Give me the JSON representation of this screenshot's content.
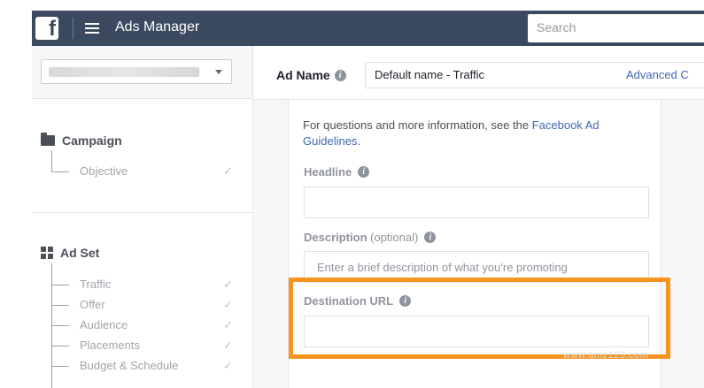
{
  "header": {
    "logo": "f",
    "app_title": "Ads Manager",
    "search_placeholder": "Search"
  },
  "ad_name": {
    "label": "Ad Name",
    "value": "Default name - Traffic",
    "advanced_link": "Advanced C"
  },
  "sidebar": {
    "campaign": {
      "title": "Campaign",
      "items": [
        "Objective"
      ]
    },
    "ad_set": {
      "title": "Ad Set",
      "items": [
        "Traffic",
        "Offer",
        "Audience",
        "Placements",
        "Budget & Schedule"
      ]
    },
    "check_mark": "✓"
  },
  "form": {
    "guidelines_text": "For questions and more information, see the ",
    "guidelines_link": "Facebook Ad Guidelines",
    "guidelines_end": ".",
    "headline_label": "Headline",
    "headline_value": "",
    "description_label": "Description",
    "description_optional": "(optional)",
    "description_placeholder": "Enter a brief description of what you're promoting",
    "destination_label": "Destination URL",
    "destination_value": ""
  },
  "colors": {
    "topbar": "#3b4a5e",
    "highlight": "#f7941d",
    "link": "#4267b2"
  },
  "icons": {
    "logo": "facebook-logo-icon",
    "menu": "hamburger-menu-icon",
    "info": "info-icon",
    "campaign": "folder-icon",
    "ad_set": "grid-icon",
    "dropdown": "caret-down-icon"
  },
  "watermark": "www.amz123.com"
}
